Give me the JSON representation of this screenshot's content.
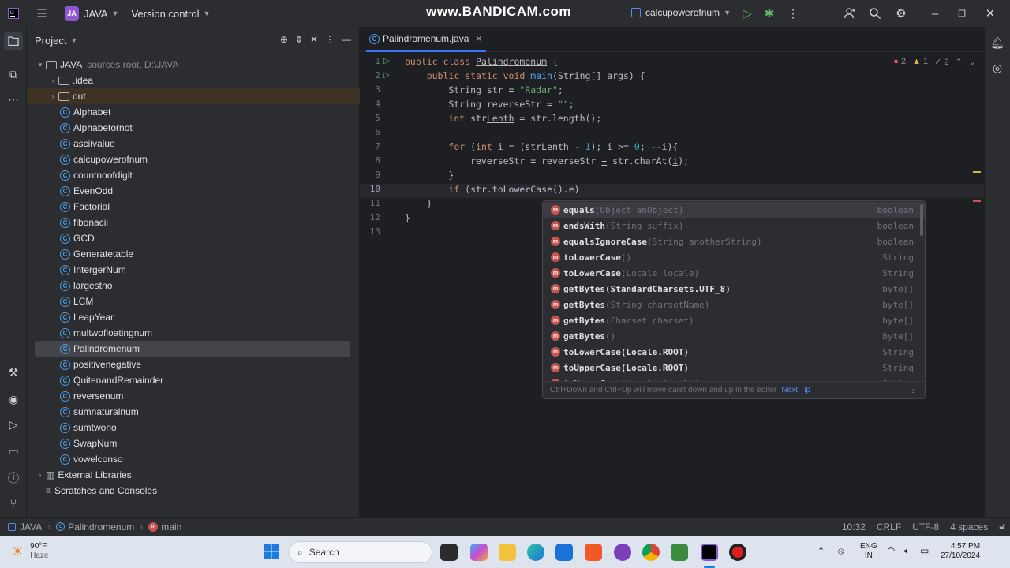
{
  "titlebar": {
    "project_badge": "JA",
    "project_name": "JAVA",
    "vcs": "Version control",
    "watermark": "www.BANDICAM.com",
    "run_config": "calcupowerofnum"
  },
  "project_panel": {
    "title": "Project",
    "root_name": "JAVA",
    "root_hint": "sources root, D:\\JAVA",
    "folders": [
      ".idea",
      "out"
    ],
    "classes": [
      "Alphabet",
      "Alphabetornot",
      "asciivalue",
      "calcupowerofnum",
      "countnoofdigit",
      "EvenOdd",
      "Factorial",
      "fibonacii",
      "GCD",
      "Generatetable",
      "IntergerNum",
      "largestno",
      "LCM",
      "LeapYear",
      "multwofloatingnum",
      "Palindromenum",
      "positivenegative",
      "QuitenandRemainder",
      "reversenum",
      "sumnaturalnum",
      "sumtwono",
      "SwapNum",
      "vowelconso"
    ],
    "selected": "Palindromenum",
    "external": "External Libraries",
    "scratches": "Scratches and Consoles"
  },
  "editor": {
    "tab_name": "Palindromenum.java",
    "inspections": {
      "errors": "2",
      "warnings": "1",
      "weak": "2"
    },
    "line_numbers": [
      "1",
      "2",
      "3",
      "4",
      "5",
      "6",
      "7",
      "8",
      "9",
      "10",
      "11",
      "12",
      "13"
    ],
    "current_line": "10"
  },
  "completion": {
    "items": [
      {
        "name": "equals",
        "args": "(Object anObject)",
        "type": "boolean"
      },
      {
        "name": "endsWith",
        "args": "(String suffix)",
        "type": "boolean"
      },
      {
        "name": "equalsIgnoreCase",
        "args": "(String anotherString)",
        "type": "boolean"
      },
      {
        "name": "toLowerCase",
        "args": "()",
        "type": "String"
      },
      {
        "name": "toLowerCase",
        "args": "(Locale locale)",
        "type": "String"
      },
      {
        "name": "getBytes(StandardCharsets.UTF_8)",
        "args": "",
        "type": "byte[]"
      },
      {
        "name": "getBytes",
        "args": "(String charsetName)",
        "type": "byte[]"
      },
      {
        "name": "getBytes",
        "args": "(Charset charset)",
        "type": "byte[]"
      },
      {
        "name": "getBytes",
        "args": "()",
        "type": "byte[]"
      },
      {
        "name": "toLowerCase(Locale.ROOT)",
        "args": "",
        "type": "String"
      },
      {
        "name": "toUpperCase(Locale.ROOT)",
        "args": "",
        "type": "String"
      },
      {
        "name": "toUpperCase",
        "args": "(Locale locale)",
        "type": "String"
      }
    ],
    "footer": "Ctrl+Down and Ctrl+Up will move caret down and up in the editor",
    "next_tip": "Next Tip"
  },
  "statusbar": {
    "crumbs": [
      "JAVA",
      "Palindromenum",
      "main"
    ],
    "position": "10:32",
    "line_sep": "CRLF",
    "encoding": "UTF-8",
    "indent": "4 spaces"
  },
  "taskbar": {
    "weather_temp": "90°F",
    "weather_desc": "Haze",
    "search_placeholder": "Search",
    "lang1": "ENG",
    "lang2": "IN",
    "time": "4:57 PM",
    "date": "27/10/2024"
  }
}
